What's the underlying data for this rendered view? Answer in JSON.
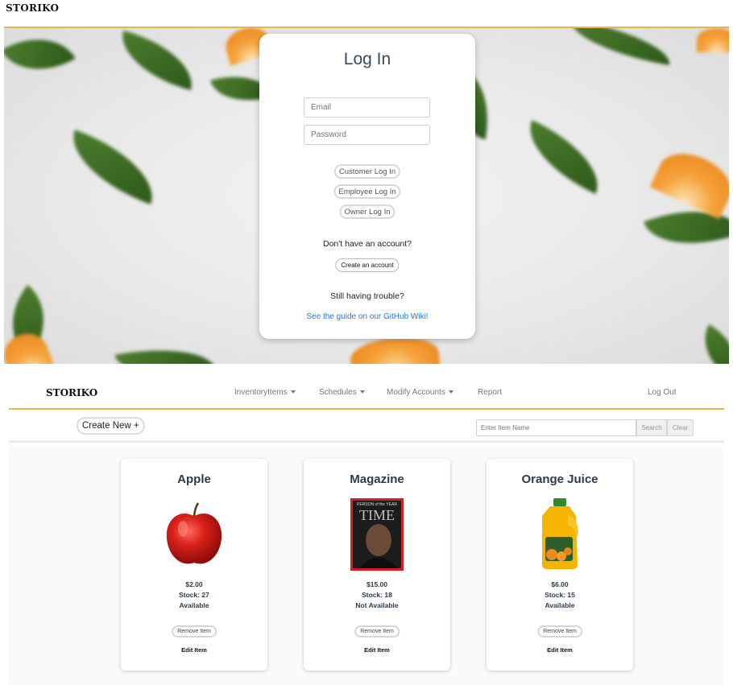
{
  "login": {
    "brand": "STORIKO",
    "title": "Log In",
    "email_placeholder": "Email",
    "password_placeholder": "Password",
    "customer_button": "Customer Log In",
    "employee_button": "Employee Log In",
    "owner_button": "Owner Log In",
    "no_account_text": "Don't have an account?",
    "create_account_button": "Create an account",
    "trouble_text": "Still having trouble?",
    "guide_link": "See the guide on our GitHub Wiki!"
  },
  "inventory": {
    "brand": "STORIKO",
    "nav": {
      "inventory_items": "InventoryItems",
      "schedules": "Schedules",
      "modify_accounts": "Modify Accounts",
      "report": "Report",
      "log_out": "Log Out"
    },
    "create_new": "Create New +",
    "search_placeholder": "Enter Item Name",
    "search_button": "Search",
    "clear_button": "Clear",
    "items": [
      {
        "name": "Apple",
        "price": "$2.00",
        "stock": "Stock: 27",
        "availability": "Available",
        "remove": "Remove Item",
        "edit": "Edit Item"
      },
      {
        "name": "Magazine",
        "price": "$15.00",
        "stock": "Stock: 18",
        "availability": "Not Available",
        "remove": "Remove Item",
        "edit": "Edit Item",
        "cover_title": "TIME",
        "cover_kicker": "PERSON of the YEAR"
      },
      {
        "name": "Orange Juice",
        "price": "$6.00",
        "stock": "Stock: 15",
        "availability": "Available",
        "remove": "Remove Item",
        "edit": "Edit Item"
      }
    ]
  },
  "colors": {
    "accent_orange": "#f2b04b",
    "link_blue": "#1a7bd6",
    "title_text": "#2e3b4a"
  }
}
